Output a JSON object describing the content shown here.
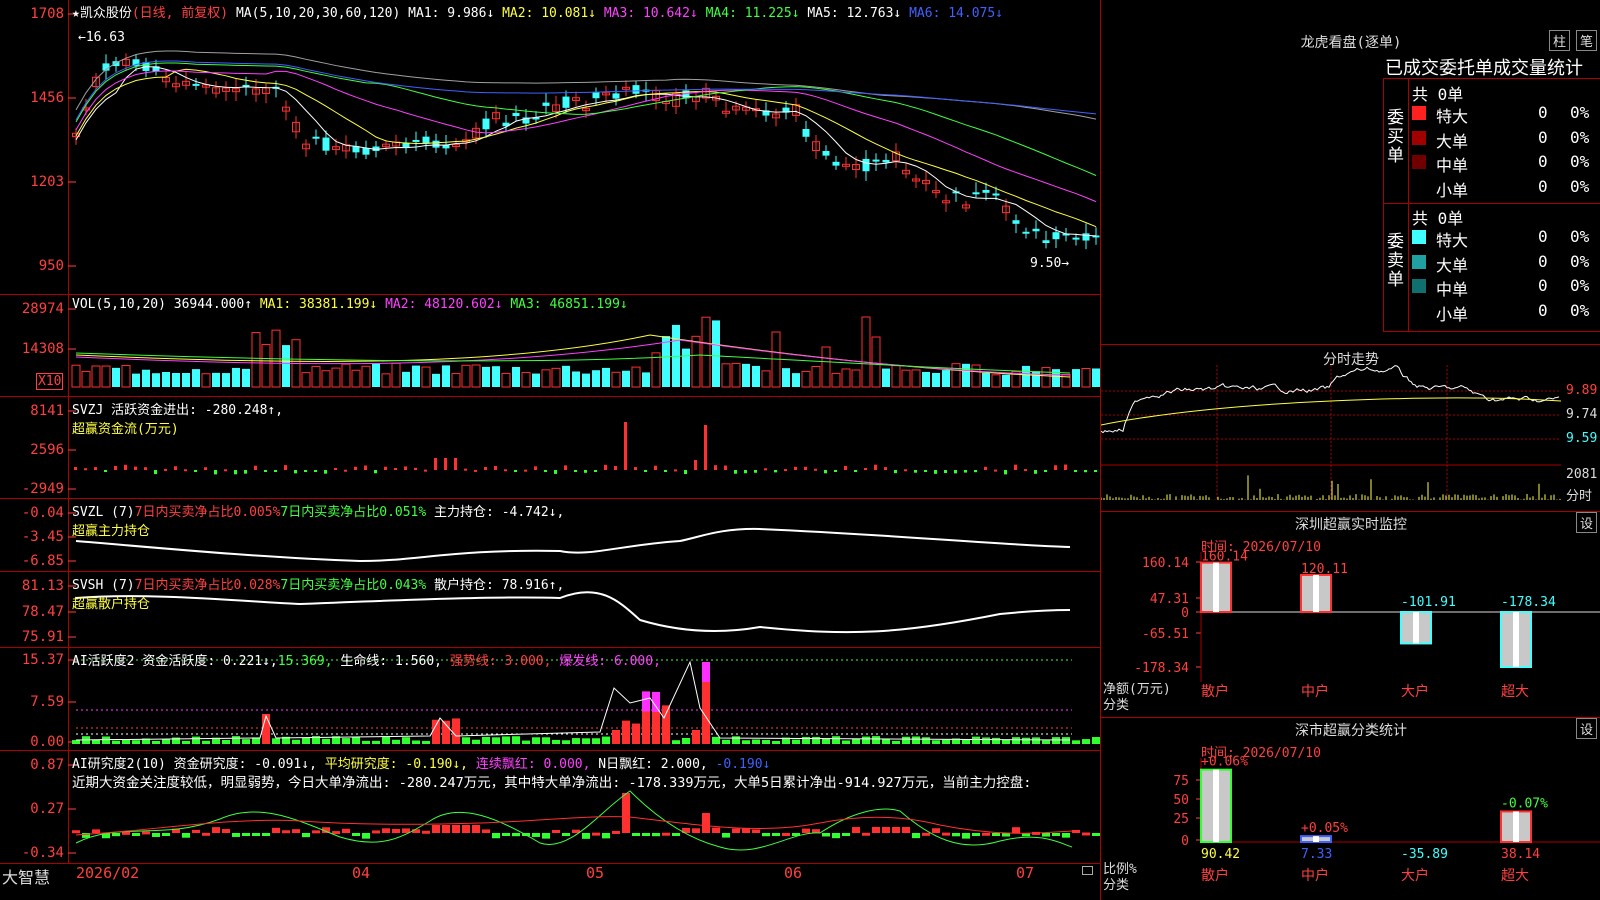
{
  "main": {
    "header": {
      "name": "★凯众股份",
      "mode": "(日线, 前复权)",
      "ma_def": "MA(5,10,20,30,60,120)",
      "ma1": "MA1: 9.986↓",
      "ma2": "MA2: 10.081↓",
      "ma3": "MA3: 10.642↓",
      "ma4": "MA4: 11.225↓",
      "ma5": "MA5: 12.763↓",
      "ma6": "MA6: 14.075↓"
    },
    "yticks": [
      "1708",
      "1456",
      "1203",
      "950"
    ],
    "hi_label": "←16.63",
    "lo_label": "9.50→"
  },
  "vol": {
    "header": {
      "def": "VOL(5,10,20)",
      "val": "36944.000↑",
      "ma1": "MA1: 38381.199↓",
      "ma2": "MA2: 48120.602↓",
      "ma3": "MA3: 46851.199↓"
    },
    "yticks": [
      "28974",
      "14308"
    ],
    "unit": "X10"
  },
  "svzj": {
    "header": {
      "def": "SVZJ",
      "label": "活跃资金进出: -280.248↑,",
      "sub": "超赢资金流(万元)"
    },
    "yticks": [
      "8141",
      "2596",
      "-2949"
    ]
  },
  "svzl": {
    "header": {
      "def": "SVZL (7)",
      "a": "7日内买卖净占比0.005%",
      "b": "7日内买卖净占比0.051%",
      "c": "主力持仓: -4.742↓,",
      "sub": "超赢主力持仓"
    },
    "yticks": [
      "-0.04",
      "-3.45",
      "-6.85"
    ]
  },
  "svsh": {
    "header": {
      "def": "SVSH (7)",
      "a": "7日内买卖净占比0.028%",
      "b": "7日内买卖净占比0.043%",
      "c": "散户持仓: 78.916↑,",
      "sub": "超赢散户持仓"
    },
    "yticks": [
      "81.13",
      "78.47",
      "75.91"
    ]
  },
  "ai1": {
    "header": {
      "def": "AI活跃度2",
      "a": "资金活跃度: 0.221↓,",
      "b": "15.369,",
      "c": "生命线: 1.560,",
      "d": "强势线: 3.000,",
      "e": "爆发线: 6.000,"
    },
    "yticks": [
      "15.37",
      "7.59",
      "0.00"
    ]
  },
  "ai2": {
    "header": {
      "def": "AI研究度2(10)",
      "a": "资金研究度: -0.091↓,",
      "b": "平均研究度: -0.190↓,",
      "c": "连续飘红: 0.000,",
      "d": "N日飘红: 2.000,",
      "e": "-0.190↓"
    },
    "note": "近期大资金关注度较低，明显弱势，今日大单净流出: -280.247万元，其中特大单净流出: -178.339万元，大单5日累计净出-914.927万元，当前主力控盘:",
    "yticks": [
      "0.87",
      "0.27",
      "-0.34"
    ]
  },
  "xaxis": {
    "labels": [
      "2026/02",
      "04",
      "05",
      "06",
      "07"
    ],
    "brand": "大智慧"
  },
  "lhb": {
    "title": "龙虎看盘(逐单)",
    "btn1": "柱",
    "btn2": "笔",
    "subtitle": "已成交委托单成交量统计",
    "buy": {
      "side": "委买单",
      "total": "共 0单",
      "rows": [
        {
          "name": "特大",
          "n": "0",
          "p": "0%",
          "color": "#ff2020"
        },
        {
          "name": "大单",
          "n": "0",
          "p": "0%",
          "color": "#a00000"
        },
        {
          "name": "中单",
          "n": "0",
          "p": "0%",
          "color": "#700000"
        },
        {
          "name": "小单",
          "n": "0",
          "p": "0%",
          "color": "#000000"
        }
      ]
    },
    "sell": {
      "side": "委卖单",
      "total": "共 0单",
      "rows": [
        {
          "name": "特大",
          "n": "0",
          "p": "0%",
          "color": "#40ffff"
        },
        {
          "name": "大单",
          "n": "0",
          "p": "0%",
          "color": "#20a0a0"
        },
        {
          "name": "中单",
          "n": "0",
          "p": "0%",
          "color": "#107070"
        },
        {
          "name": "小单",
          "n": "0",
          "p": "0%",
          "color": "#000000"
        }
      ]
    }
  },
  "intraday": {
    "title": "分时走势",
    "p1": "9.89",
    "p2": "9.74",
    "p3": "9.59",
    "vol": "2081",
    "unit": "分时"
  },
  "szmon": {
    "title": "深圳超赢实时监控",
    "set": "设",
    "time": "时间: 2026/07/10",
    "yticks": [
      "160.14",
      "47.31",
      "0",
      "-65.51",
      "-178.34"
    ],
    "ylabel1": "净额(万元)",
    "ylabel2": "分类",
    "cats": [
      "散户",
      "中户",
      "大户",
      "超大"
    ],
    "vals": [
      "160.14",
      "120.11",
      "-101.91",
      "-178.34"
    ]
  },
  "szcls": {
    "title": "深市超赢分类统计",
    "set": "设",
    "time": "时间: 2026/07/10",
    "yticks": [
      "75",
      "50",
      "25",
      "0"
    ],
    "ylabel1": "比例%",
    "ylabel2": "分类",
    "cats": [
      "散户",
      "中户",
      "大户",
      "超大"
    ],
    "top": [
      "+0.06%",
      "+0.05%",
      "",
      "-0.07%"
    ],
    "vals": [
      "90.42",
      "7.33",
      "-35.89",
      "38.14"
    ]
  }
}
